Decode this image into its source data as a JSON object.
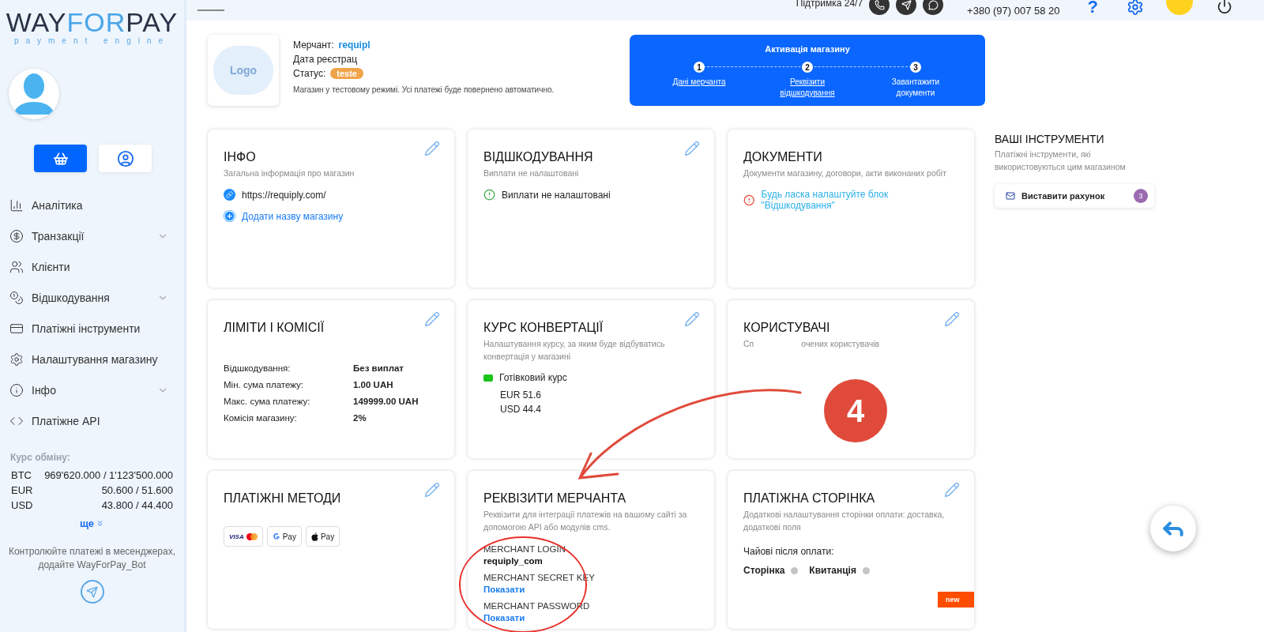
{
  "sidebar": {
    "logo": {
      "parts": [
        "WAY",
        "FOR",
        "PAY"
      ],
      "tagline": "payment engine"
    },
    "mode_buttons": [
      {
        "kind": "basket",
        "selected": true
      },
      {
        "kind": "user",
        "selected": false
      }
    ],
    "menu": [
      {
        "label": "Аналітика",
        "kind": "analytics",
        "expandable": false
      },
      {
        "label": "Транзакції",
        "kind": "transactions",
        "expandable": true
      },
      {
        "label": "Клієнти",
        "kind": "clients",
        "expandable": false
      },
      {
        "label": "Відшкодування",
        "kind": "payouts",
        "expandable": true
      },
      {
        "label": "Платіжні інструменти",
        "kind": "tools",
        "expandable": false
      },
      {
        "label": "Налаштування магазину",
        "kind": "settings",
        "expandable": false
      },
      {
        "label": "Інфо",
        "kind": "info",
        "expandable": true
      },
      {
        "label": "Платіжне API",
        "kind": "api",
        "expandable": false
      }
    ],
    "rates": {
      "title": "Курс обміну:",
      "rows": [
        {
          "currency": "BTC",
          "value": "969'620.000 / 1'123'500.000"
        },
        {
          "currency": "EUR",
          "value": "50.600 / 51.600"
        },
        {
          "currency": "USD",
          "value": "43.800 / 44.400"
        }
      ],
      "more": "ще"
    },
    "promo": "Контролюйте платежі в месенджерах, додайте WayForPay_Bot"
  },
  "header": {
    "support": "Підтримка 24/7",
    "phone": "+380 (97) 007 58 20",
    "help": "?"
  },
  "shop": {
    "logo_label": "Logo",
    "fields": [
      {
        "label": "Мерчант:",
        "value": "requipl",
        "kind": "link"
      },
      {
        "label": "Дата реєстрац",
        "kind": "plain"
      },
      {
        "label": "Статус:",
        "value": "teste",
        "kind": "badge"
      }
    ],
    "note": "Магазин у тестовому режимі. Усі платежі буде повернено автоматично."
  },
  "activation": {
    "title": "Активація магазину",
    "steps": [
      {
        "number": "1",
        "label": "Дані мерчанта",
        "link": true
      },
      {
        "number": "2",
        "label": "Реквізити відшкодування",
        "link": true
      },
      {
        "number": "3",
        "label": "Завантажити документи",
        "link": false
      }
    ]
  },
  "cards": [
    {
      "kind": "info",
      "title": "ІНФО",
      "subtitle": "Загальна інформація про магазин",
      "editable": true,
      "site": "https://requiply.com/",
      "add_name": "Додати назву магазину"
    },
    {
      "kind": "status",
      "title": "ВІДШКОДУВАННЯ",
      "subtitle": "Виплати не налаштовані",
      "editable": true,
      "status": "Виплати не налаштовані"
    },
    {
      "kind": "warning",
      "title": "ДОКУМЕНТИ",
      "subtitle": "Документи магазину, договори, акти виконаних робіт",
      "editable": false,
      "warning": "Будь ласка налаштуйте блок \"Відшкодування\""
    },
    {
      "kind": "limits",
      "title": "ЛІМІТИ І КОМІСІЇ",
      "editable": true,
      "rows": [
        {
          "label": "Відшкодування:",
          "value": "Без виплат"
        },
        {
          "label": "Мін. сума платежу:",
          "value": "1.00 UAH"
        },
        {
          "label": "Макс. сума платежу:",
          "value": "149999.00 UAH"
        },
        {
          "label": "Комісія магазину:",
          "value": "2%"
        }
      ]
    },
    {
      "kind": "rate",
      "title": "КУРС КОНВЕРТАЦІЇ",
      "subtitle": "Налаштування курсу, за яким буде відбуватись конвертація у магазині",
      "editable": true,
      "rate_type": "Готівковий курс",
      "lines": [
        "EUR 51.6",
        "USD 44.4"
      ]
    },
    {
      "kind": "users",
      "title": "КОРИСТУВАЧІ",
      "subtitle_fragments": [
        "Сп",
        "очених користувачів"
      ],
      "editable": true
    },
    {
      "kind": "methods",
      "title": "ПЛАТІЖНІ МЕТОДИ",
      "editable": true,
      "methods": [
        {
          "kind": "visa",
          "label": "VISA"
        },
        {
          "kind": "gpay",
          "label": "Pay"
        },
        {
          "kind": "apple",
          "label": "Pay"
        }
      ]
    },
    {
      "kind": "requisites",
      "title": "РЕКВІЗИТИ МЕРЧАНТА",
      "subtitle": "Реквізити для інтеграції платежів на вашому сайті за допомогою API або модулів cms.",
      "editable": false,
      "fields": [
        {
          "label": "MERCHANT LOGIN",
          "value": "requiply_com",
          "kind": "value"
        },
        {
          "label": "MERCHANT SECRET KEY",
          "value": "Показати",
          "kind": "link"
        },
        {
          "label": "MERCHANT PASSWORD",
          "value": "Показати",
          "kind": "link"
        }
      ]
    },
    {
      "kind": "payment_page",
      "title": "ПЛАТІЖНА СТОРІНКА",
      "subtitle": "Додаткові налаштування сторінки оплати: доставка, додаткові поля",
      "editable": true,
      "tips_label": "Чайові після оплати:",
      "options": [
        {
          "label": "Сторінка",
          "on": false
        },
        {
          "label": "Квитанція",
          "on": false
        }
      ],
      "badge": "new"
    }
  ],
  "tools": {
    "title": "ВАШІ ІНСТРУМЕНТИ",
    "subtitle": "Платіжні інструменти, які використовуються цим магазином",
    "items": [
      {
        "label": "Виставити рахунок",
        "count": "3"
      }
    ]
  },
  "annotation": {
    "number": "4"
  }
}
